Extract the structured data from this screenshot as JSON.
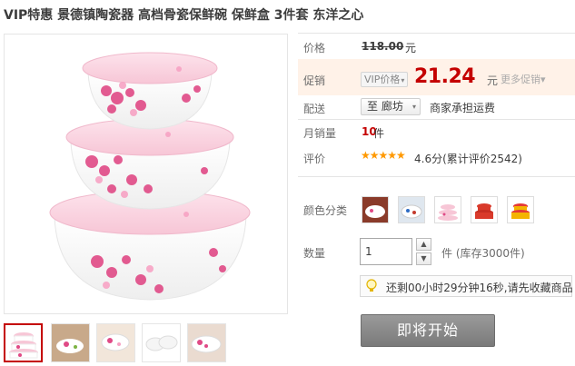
{
  "product": {
    "title": "VIP特惠 景德镇陶瓷器 高档骨瓷保鲜碗 保鲜盒 3件套 东洋之心"
  },
  "price": {
    "label": "价格",
    "original": "118.00",
    "original_unit": "元"
  },
  "promo": {
    "label": "促销",
    "vip_tag": "VIP价格",
    "vip_caret": "▾",
    "price": "21.24",
    "unit": "元",
    "more": "更多促销",
    "more_caret": "▾"
  },
  "shipping": {
    "label": "配送",
    "location": "至 廊坊",
    "location_arrow": "▾",
    "note": "商家承担运费"
  },
  "sales": {
    "label": "月销量",
    "count": "10",
    "unit": "件"
  },
  "rating": {
    "label": "评价",
    "stars": "★★★★★",
    "score": 4.6,
    "text": "4.6分(累计评价2542)"
  },
  "color": {
    "label": "颜色分类",
    "swatches": [
      "swatch-1",
      "swatch-2",
      "swatch-3",
      "swatch-4",
      "swatch-5"
    ],
    "selected_index": 2
  },
  "quantity": {
    "label": "数量",
    "value": "1",
    "up": "▲",
    "down": "▼",
    "stock_text": "件 (库存3000件)"
  },
  "notice": {
    "icon": "lightbulb-icon",
    "text": "还剩00小时29分钟16秒,请先收藏商品"
  },
  "action": {
    "start_label": "即将开始"
  },
  "thumbnails": {
    "count": 5,
    "active_index": 0
  },
  "colors": {
    "accent_red": "#c40000",
    "star_orange": "#ff9900",
    "promo_bg": "#fff2e8",
    "button_gray": "#8a8a8a"
  }
}
